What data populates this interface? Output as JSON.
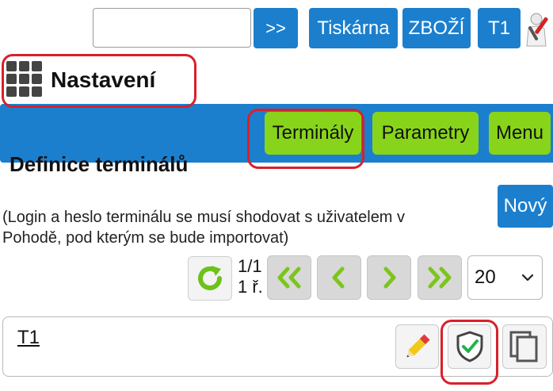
{
  "toolbar": {
    "search_value": "",
    "go_label": ">>",
    "printer_label": "Tiskárna",
    "goods_label": "ZBOŽÍ",
    "terminal_label": "T1",
    "user_icon": "user-wrench-icon"
  },
  "header": {
    "title": "Nastavení",
    "icon": "grid-icon"
  },
  "nav": {
    "items": [
      {
        "label": "Terminály"
      },
      {
        "label": "Parametry"
      },
      {
        "label": "Menu"
      }
    ]
  },
  "section": {
    "title": "Definice terminálů",
    "new_label": "Nový",
    "note_line1": "(Login a heslo terminálu se musí shodovat s uživatelem v",
    "note_line2": "Pohodě, pod kterým se bude importovat)"
  },
  "pager": {
    "pages": "1/1",
    "rows": "1 ř.",
    "page_size": "20"
  },
  "list": {
    "rows": [
      {
        "name": "T1"
      }
    ]
  },
  "colors": {
    "primary_blue": "#1b7fce",
    "nav_green": "#88d41a",
    "highlight_red": "#d8202a"
  }
}
